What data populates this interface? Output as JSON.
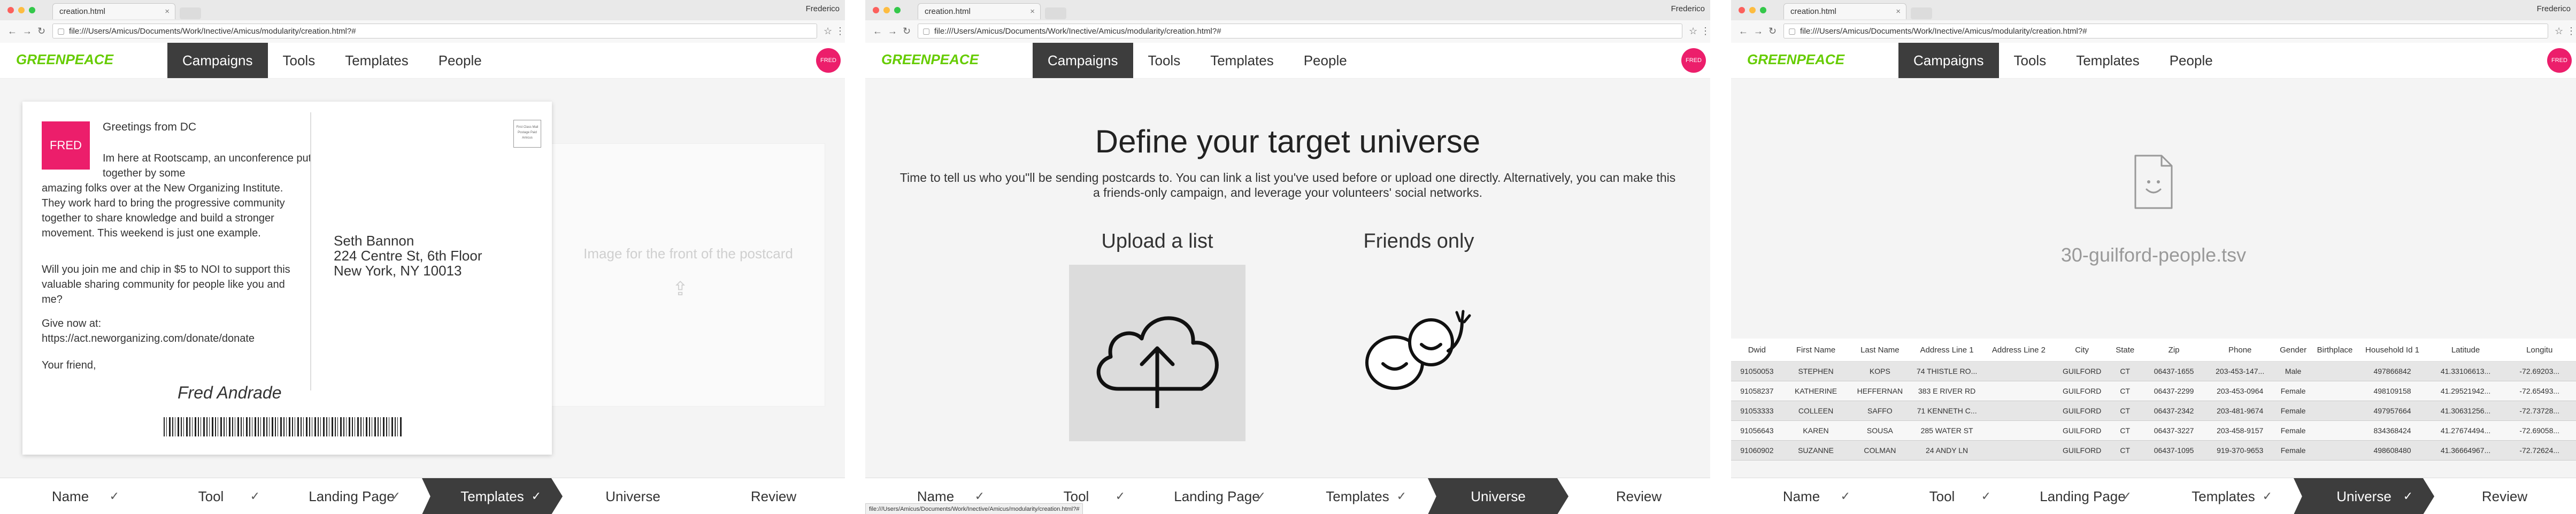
{
  "browser": {
    "tab_title": "creation.html",
    "tab_close": "×",
    "user": "Frederico",
    "url": "file:///Users/Amicus/Documents/Work/Inective/Amicus/modularity/creation.html?#",
    "back": "←",
    "forward": "→",
    "reload": "↻",
    "page_icon": "▢",
    "star": "☆",
    "menu": "⋮"
  },
  "nav": {
    "logo": "GREENPEACE",
    "items": [
      "Campaigns",
      "Tools",
      "Templates",
      "People"
    ],
    "active": "Campaigns",
    "avatar": "FRED"
  },
  "steps": {
    "labels": [
      "Name",
      "Tool",
      "Landing Page",
      "Templates",
      "Universe",
      "Review"
    ],
    "check": "✓"
  },
  "window1": {
    "current_step": "Templates",
    "fred_badge": "FRED",
    "greeting": "Greetings from DC",
    "body_first": "Im here at Rootscamp, an unconference put together by some",
    "body_rest": "amazing folks over at the New Organizing Institute. They work hard to bring the progressive community together to share knowledge and build a stronger movement. This weekend is just one example.",
    "ask": "Will you join me and chip in $5 to NOI to support this valuable sharing community for people like you and me?",
    "give_label": "Give now at:",
    "give_link": "https://act.neworganizing.com/donate/donate",
    "closing": "Your friend,",
    "signature": "Fred Andrade",
    "address_lines": [
      "Seth Bannon",
      "224 Centre St, 6th Floor",
      "New York, NY 10013"
    ],
    "stamp_text": "First Class Mail Postage Paid Amicus",
    "front_placeholder": "Image for the front of the postcard",
    "upload_icon": "⇪"
  },
  "window2": {
    "current_step": "Universe",
    "heading": "Define your target universe",
    "intro": "Time to tell us who you\"ll be sending postcards to. You can link a list you've used before or upload one directly. Alternatively, you can make this a friends-only campaign, and leverage your volunteers' social networks.",
    "option_upload": "Upload a list",
    "option_friends": "Friends only",
    "status_url": "file:///Users/Amicus/Documents/Work/Inective/Amicus/modularity/creation.html?#"
  },
  "window3": {
    "current_step": "Universe",
    "file_name": "30-guilford-people.tsv",
    "columns": [
      "Dwid",
      "First Name",
      "Last Name",
      "Address Line 1",
      "Address Line 2",
      "City",
      "State",
      "Zip",
      "Phone",
      "Gender",
      "Birthplace",
      "Household Id 1",
      "Latitude",
      "Longitu"
    ],
    "rows": [
      [
        "91050053",
        "STEPHEN",
        "KOPS",
        "74 THISTLE RO...",
        "",
        "GUILFORD",
        "CT",
        "06437-1655",
        "203-453-147...",
        "Male",
        "",
        "497866842",
        "41.33106613...",
        "-72.69203..."
      ],
      [
        "91058237",
        "KATHERINE",
        "HEFFERNAN",
        "383 E RIVER RD",
        "",
        "GUILFORD",
        "CT",
        "06437-2299",
        "203-453-0964",
        "Female",
        "",
        "498109158",
        "41.29521942...",
        "-72.65493..."
      ],
      [
        "91053333",
        "COLLEEN",
        "SAFFO",
        "71 KENNETH C...",
        "",
        "GUILFORD",
        "CT",
        "06437-2342",
        "203-481-9674",
        "Female",
        "",
        "497957664",
        "41.30631256...",
        "-72.73728..."
      ],
      [
        "91056643",
        "KAREN",
        "SOUSA",
        "285 WATER ST",
        "",
        "GUILFORD",
        "CT",
        "06437-3227",
        "203-458-9157",
        "Female",
        "",
        "834368424",
        "41.27674494...",
        "-72.69058..."
      ],
      [
        "91060902",
        "SUZANNE",
        "COLMAN",
        "24 ANDY LN",
        "",
        "GUILFORD",
        "CT",
        "06437-1095",
        "919-370-9653",
        "Female",
        "",
        "498608480",
        "41.36664967...",
        "-72.72624..."
      ]
    ]
  }
}
